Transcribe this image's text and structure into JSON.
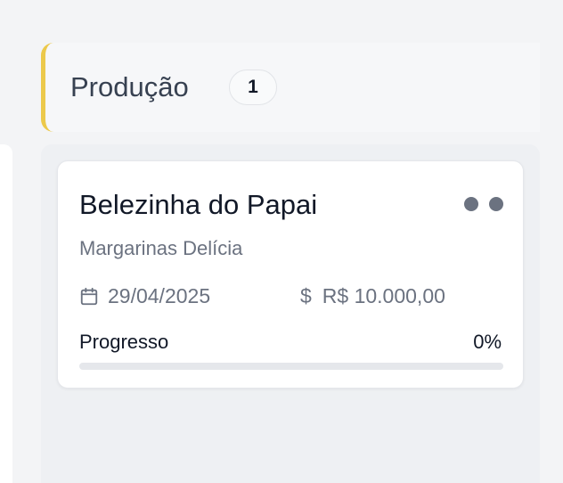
{
  "column": {
    "title": "Produção",
    "count": "1",
    "accent_color": "#ecc94b"
  },
  "card": {
    "title": "Belezinha do Papai",
    "client": "Margarinas Delícia",
    "date": "29/04/2025",
    "value": "R$ 10.000,00",
    "progress_label": "Progresso",
    "progress_text": "0%",
    "progress_fraction": 0,
    "icons": {
      "menu": "more-dots-icon",
      "date": "calendar-icon",
      "value": "dollar-icon"
    }
  }
}
